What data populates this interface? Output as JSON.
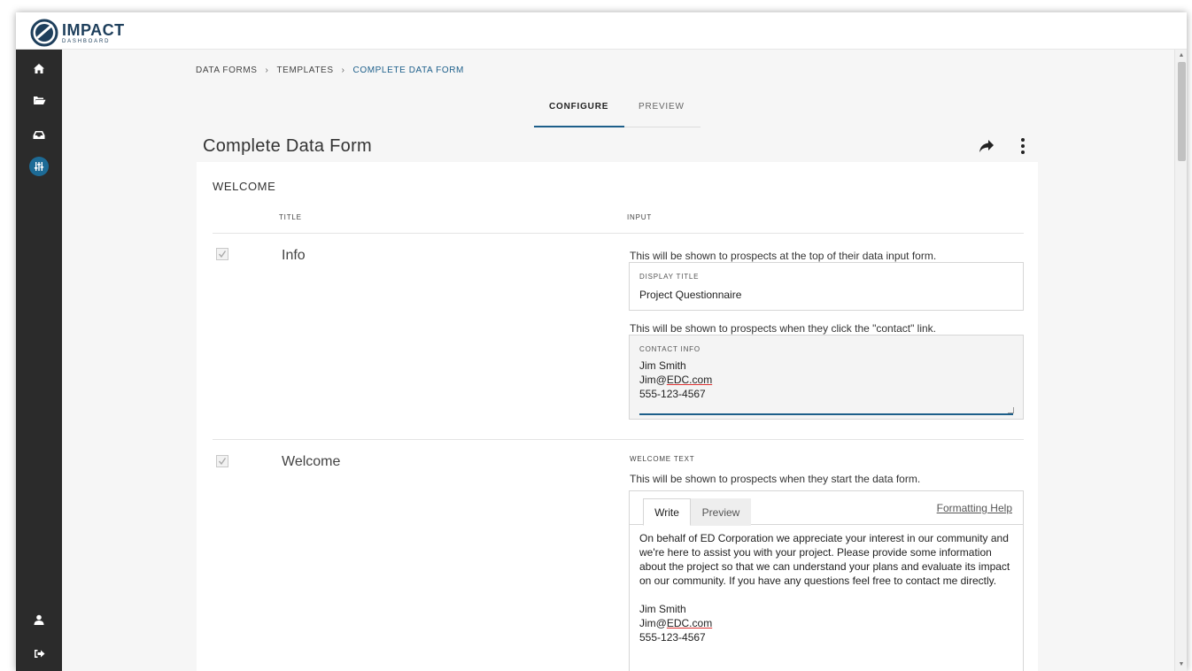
{
  "app": {
    "name": "IMPACT",
    "subtitle": "DASHBOARD"
  },
  "sidebar": {
    "items": [
      {
        "name": "home",
        "icon": "home-icon"
      },
      {
        "name": "folder",
        "icon": "folder-open-icon"
      },
      {
        "name": "inbox",
        "icon": "inbox-icon"
      },
      {
        "name": "settings",
        "icon": "sliders-icon",
        "active": true
      }
    ],
    "bottom": [
      {
        "name": "user",
        "icon": "user-icon"
      },
      {
        "name": "logout",
        "icon": "sign-out-icon"
      }
    ]
  },
  "breadcrumb": {
    "items": [
      "DATA FORMS",
      "TEMPLATES",
      "COMPLETE DATA FORM"
    ],
    "separator": "›"
  },
  "tabs": {
    "configure": "CONFIGURE",
    "preview": "PREVIEW",
    "active": "configure"
  },
  "page": {
    "title": "Complete Data Form"
  },
  "section": {
    "title": "WELCOME",
    "col_title": "TITLE",
    "col_input": "INPUT"
  },
  "rows": {
    "info": {
      "label": "Info",
      "display_hint": "This will be shown to prospects at the top of their data input form.",
      "display_label": "DISPLAY TITLE",
      "display_value": "Project Questionnaire",
      "contact_hint": "This will be shown to prospects when they click the \"contact\" link.",
      "contact_label": "CONTACT INFO",
      "contact_line1": "Jim Smith",
      "contact_line2_prefix": "Jim@",
      "contact_line2_link": "EDC.com",
      "contact_line3": "555-123-4567"
    },
    "welcome": {
      "label": "Welcome",
      "field_label": "WELCOME TEXT",
      "hint": "This will be shown to prospects when they start the data form.",
      "tab_write": "Write",
      "tab_preview": "Preview",
      "help": "Formatting Help",
      "body_paragraph": "On behalf of ED Corporation we appreciate your interest in our community and we're here to assist you with your project. Please provide some information about the project so that we can understand your plans and evaluate its impact on our community. If you have any questions feel free to contact me directly.",
      "sig_line1": "Jim Smith",
      "sig_line2_prefix": "Jim@",
      "sig_line2_link": "EDC.com",
      "sig_line3": "555-123-4567"
    }
  },
  "colors": {
    "accent": "#1d5f8a",
    "sidebar": "#2b2b2b",
    "brand": "#1e3f5c"
  }
}
